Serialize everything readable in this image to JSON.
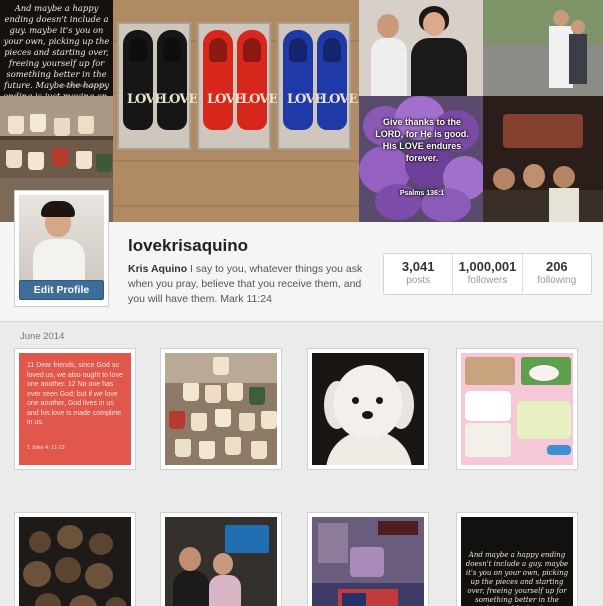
{
  "header_collage": {
    "quote_text": "And maybe a happy ending doesn't include a guy. maybe it's you on your own, picking up the pieces and starting over, freeing yourself up for something better in the future. Maybe the happy ending is just moving on.",
    "quote_credit": "quotefeelings.com",
    "shoe_text": "LOVE",
    "flower_text": "Give thanks to the LORD, for He is good. His LOVE endures forever.",
    "flower_ref": "Psalms 136:1"
  },
  "profile": {
    "username": "lovekrisaquino",
    "full_name": "Kris Aquino",
    "bio": "I say to you, whatever things you ask when you pray, believe that you receive them, and you will have them. Mark 11:24",
    "edit_button": "Edit Profile",
    "stats": [
      {
        "value": "3,041",
        "label": "posts"
      },
      {
        "value": "1,000,001",
        "label": "followers"
      },
      {
        "value": "206",
        "label": "following"
      }
    ]
  },
  "feed": {
    "date_label": "June 2014",
    "verse_post": {
      "text": "11 Dear friends, since God so loved us, we also ought to love one another. 12 No one has ever seen God; but if we love one another, God lives in us and his love is made complete in us.",
      "reference": "1 John 4: 11-12"
    },
    "quote_post_text": "And maybe a happy ending doesn't include a guy. maybe it's you on your own, picking up the pieces and starting over, freeing yourself up for something better in the future. Maybe the"
  },
  "colors": {
    "edit_button": "#3e6d9a",
    "verse_card": "#e2574c",
    "page_bg": "#ebebeb"
  }
}
